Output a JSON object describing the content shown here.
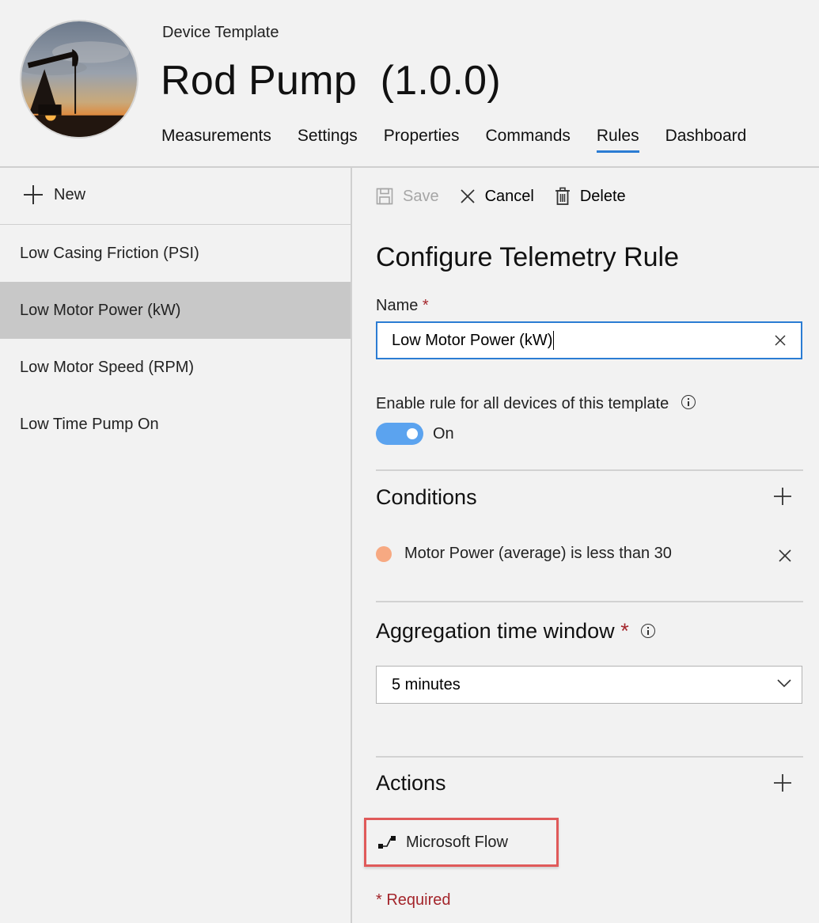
{
  "header": {
    "eyebrow": "Device Template",
    "title": "Rod Pump",
    "version": "(1.0.0)",
    "tabs": [
      {
        "label": "Measurements"
      },
      {
        "label": "Settings"
      },
      {
        "label": "Properties"
      },
      {
        "label": "Commands"
      },
      {
        "label": "Rules"
      },
      {
        "label": "Dashboard"
      }
    ],
    "active_tab": "Rules"
  },
  "sidebar": {
    "new_label": "New",
    "items": [
      {
        "label": "Low Casing Friction (PSI)"
      },
      {
        "label": "Low Motor Power (kW)"
      },
      {
        "label": "Low Motor Speed (RPM)"
      },
      {
        "label": "Low Time Pump On"
      }
    ],
    "selected": "Low Motor Power (kW)"
  },
  "toolbar": {
    "save_label": "Save",
    "cancel_label": "Cancel",
    "delete_label": "Delete"
  },
  "form": {
    "title": "Configure Telemetry Rule",
    "name_label": "Name",
    "required_mark": "*",
    "name_value": "Low Motor Power (kW)",
    "enable_label": "Enable rule for all devices of this template",
    "toggle_state": "On",
    "conditions_title": "Conditions",
    "condition_text": "Motor Power (average) is less than 30",
    "condition_color": "#f7a982",
    "aggregation_title": "Aggregation time window",
    "aggregation_value": "5 minutes",
    "actions_title": "Actions",
    "action_label": "Microsoft Flow",
    "required_note": "* Required"
  },
  "colors": {
    "accent": "#2b7cd3",
    "toggle_on": "#5ba3ef",
    "required": "#a4262c",
    "highlight_border": "#e05a5a"
  }
}
